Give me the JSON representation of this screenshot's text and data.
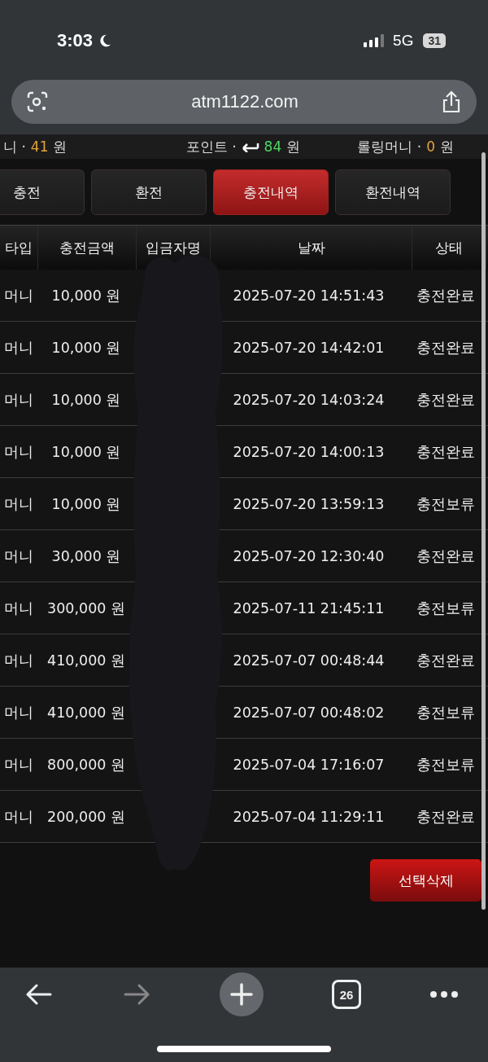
{
  "status_bar": {
    "time": "3:03",
    "network": "5G",
    "battery": "31"
  },
  "address_bar": {
    "url": "atm1122.com"
  },
  "balances": [
    {
      "label": "니 ·",
      "has_icon": false,
      "amount": "41",
      "unit": "원",
      "color": "#e6a23c"
    },
    {
      "label": "포인트 ·",
      "has_icon": true,
      "amount": "84",
      "unit": "원",
      "color": "#4cd964"
    },
    {
      "label": "롤링머니 ·",
      "has_icon": false,
      "amount": "0",
      "unit": "원",
      "color": "#e6a23c"
    }
  ],
  "tabs": [
    {
      "label": "충전",
      "selected": false
    },
    {
      "label": "환전",
      "selected": false
    },
    {
      "label": "충전내역",
      "selected": true
    },
    {
      "label": "환전내역",
      "selected": false
    }
  ],
  "table": {
    "columns": [
      "타입",
      "충전금액",
      "입금자명",
      "날짜",
      "상태"
    ],
    "rows": [
      {
        "type": "머니",
        "amount": "10,000 원",
        "date": "2025-07-20 14:51:43",
        "status": "충전완료"
      },
      {
        "type": "머니",
        "amount": "10,000 원",
        "date": "2025-07-20 14:42:01",
        "status": "충전완료"
      },
      {
        "type": "머니",
        "amount": "10,000 원",
        "date": "2025-07-20 14:03:24",
        "status": "충전완료"
      },
      {
        "type": "머니",
        "amount": "10,000 원",
        "date": "2025-07-20 14:00:13",
        "status": "충전완료"
      },
      {
        "type": "머니",
        "amount": "10,000 원",
        "date": "2025-07-20 13:59:13",
        "status": "충전보류"
      },
      {
        "type": "머니",
        "amount": "30,000 원",
        "date": "2025-07-20 12:30:40",
        "status": "충전완료"
      },
      {
        "type": "머니",
        "amount": "300,000 원",
        "date": "2025-07-11 21:45:11",
        "status": "충전보류"
      },
      {
        "type": "머니",
        "amount": "410,000 원",
        "date": "2025-07-07 00:48:44",
        "status": "충전완료"
      },
      {
        "type": "머니",
        "amount": "410,000 원",
        "date": "2025-07-07 00:48:02",
        "status": "충전보류"
      },
      {
        "type": "머니",
        "amount": "800,000 원",
        "date": "2025-07-04 17:16:07",
        "status": "충전보류"
      },
      {
        "type": "머니",
        "amount": "200,000 원",
        "date": "2025-07-04 11:29:11",
        "status": "충전완료"
      }
    ]
  },
  "delete_button": "선택삭제",
  "toolbar": {
    "tab_count": "26"
  }
}
